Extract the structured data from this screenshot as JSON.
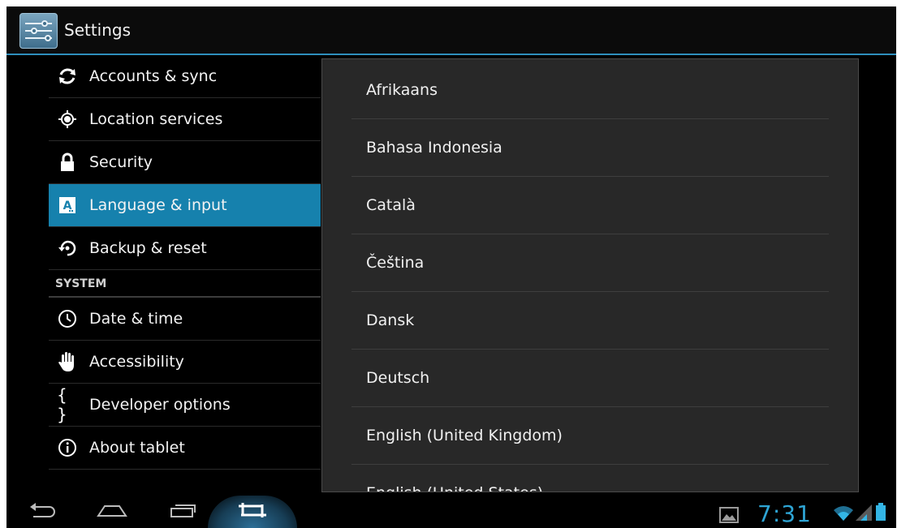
{
  "app": {
    "title": "Settings",
    "icon": "settings-icon"
  },
  "sidebar": {
    "items_top": [
      {
        "label": "Accounts & sync",
        "icon": "sync-icon"
      },
      {
        "label": "Location services",
        "icon": "location-icon"
      },
      {
        "label": "Security",
        "icon": "lock-icon"
      },
      {
        "label": "Language & input",
        "icon": "language-icon",
        "selected": true
      },
      {
        "label": "Backup & reset",
        "icon": "backup-icon"
      }
    ],
    "section_header": "SYSTEM",
    "items_system": [
      {
        "label": "Date & time",
        "icon": "clock-icon"
      },
      {
        "label": "Accessibility",
        "icon": "hand-icon"
      },
      {
        "label": "Developer options",
        "icon": "braces-icon"
      },
      {
        "label": "About tablet",
        "icon": "info-icon"
      }
    ]
  },
  "languages": [
    "Afrikaans",
    "Bahasa Indonesia",
    "Català",
    "Čeština",
    "Dansk",
    "Deutsch",
    "English (United Kingdom)",
    "English (United States)"
  ],
  "status_bar": {
    "time": "7:31"
  },
  "colors": {
    "accent": "#33b5e5",
    "selected": "#1681ad"
  }
}
